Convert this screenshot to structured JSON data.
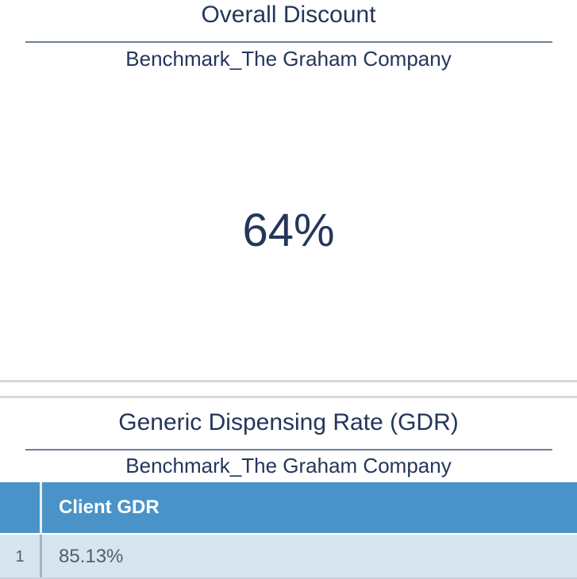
{
  "overall_discount": {
    "title": "Overall Discount",
    "subtitle": "Benchmark_The Graham Company",
    "value": "64%"
  },
  "gdr": {
    "title": "Generic Dispensing Rate (GDR)",
    "subtitle": "Benchmark_The Graham Company",
    "table": {
      "columns": [
        "Client GDR"
      ],
      "rows": [
        {
          "index": "1",
          "client_gdr": "85.13%"
        }
      ]
    }
  },
  "colors": {
    "text": "#24365a",
    "rule": "#6f7f98",
    "header_bg": "#4a93c8",
    "row_bg": "#d7e5f1",
    "separator": "#d8d8d8"
  }
}
